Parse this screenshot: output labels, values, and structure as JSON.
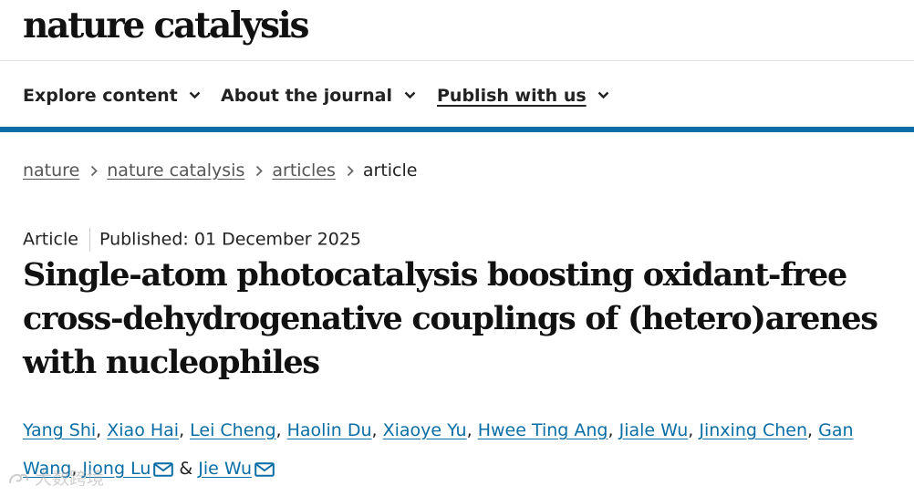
{
  "header": {
    "logo": "nature catalysis"
  },
  "nav": {
    "items": [
      {
        "label": "Explore content"
      },
      {
        "label": "About the journal"
      },
      {
        "label": "Publish with us"
      }
    ]
  },
  "breadcrumb": {
    "items": [
      "nature",
      "nature catalysis",
      "articles"
    ],
    "current": "article"
  },
  "article": {
    "type": "Article",
    "published": "Published: 01 December 2025",
    "title": "Single-atom photocatalysis boosting oxidant-free cross-dehydrogenative couplings of (hetero)arenes with nucleophiles",
    "authors": [
      "Yang Shi",
      "Xiao Hai",
      "Lei Cheng",
      "Haolin Du",
      "Xiaoye Yu",
      "Hwee Ting Ang",
      "Jiale Wu",
      "Jinxing Chen",
      "Gan Wang",
      "Jiong Lu",
      "Jie Wu"
    ],
    "author_connector": "&"
  },
  "watermark": "大数跨境",
  "colors": {
    "accent": "#0a6ea6",
    "text": "#222222"
  },
  "icons": {
    "chevron": "chevron-down-icon",
    "crumb_separator": "chevron-right-icon",
    "email": "mail-icon"
  }
}
